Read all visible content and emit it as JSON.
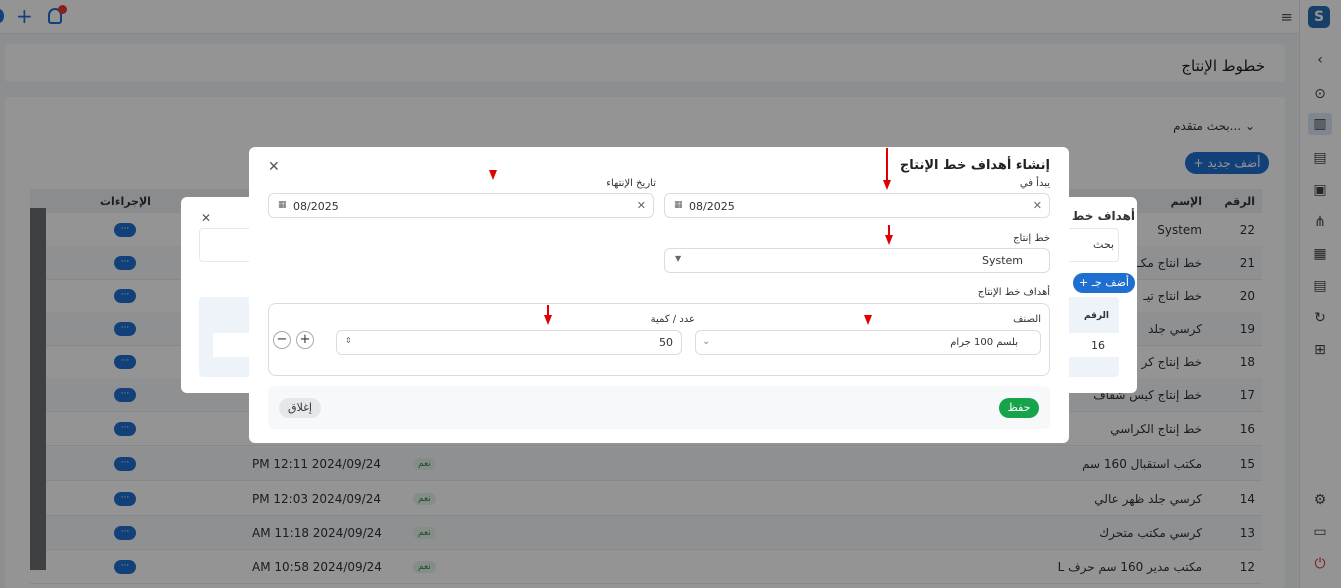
{
  "topbar": {
    "notification_badge": ""
  },
  "page": {
    "title": "خطوط الإنتاج"
  },
  "toolbar": {
    "advanced_search": "بحث متقدم...",
    "add_new": "+ أضف جديد"
  },
  "table": {
    "columns": {
      "number": "الرقم",
      "name": "الإسم",
      "actions": "الإجراءات"
    },
    "rows": [
      {
        "number": "22",
        "name": "System",
        "date": "",
        "badge": ""
      },
      {
        "number": "21",
        "name": "خط انتاج مكـ",
        "date": "",
        "badge": ""
      },
      {
        "number": "20",
        "name": "خط انتاج تيـ",
        "date": "",
        "badge": ""
      },
      {
        "number": "19",
        "name": "كرسي جلد",
        "date": "",
        "badge": ""
      },
      {
        "number": "18",
        "name": "خط إنتاج كر",
        "date": "",
        "badge": ""
      },
      {
        "number": "17",
        "name": "خط إنتاج كيس شفاف",
        "date": "",
        "badge": ""
      },
      {
        "number": "16",
        "name": "خط إنتاج الكراسي",
        "date": "",
        "badge": ""
      },
      {
        "number": "15",
        "name": "مكتب استقبال 160 سم",
        "date": "PM 12:11 2024/09/24",
        "badge": "نعم"
      },
      {
        "number": "14",
        "name": "كرسي جلد ظهر عالي",
        "date": "PM 12:03 2024/09/24",
        "badge": "نعم"
      },
      {
        "number": "13",
        "name": "كرسي مكتب متحرك",
        "date": "AM 11:18 2024/09/24",
        "badge": "نعم"
      },
      {
        "number": "12",
        "name": "مكتب مدير 160 سم حرف L",
        "date": "AM 10:58 2024/09/24",
        "badge": "نعم"
      }
    ],
    "action_label": "···"
  },
  "bg_modal": {
    "title": "أهداف خط",
    "search": "بحث",
    "add": "+ أضف جـ",
    "col_number": "الرقم",
    "cell_value": "16"
  },
  "modal": {
    "title": "إنشاء أهداف خط الإنتاج",
    "start_label": "يبدأ في",
    "start_value": "08/2025",
    "end_label": "تاريخ الإنتهاء",
    "end_value": "08/2025",
    "line_label": "خط إنتاج",
    "line_value": "System",
    "targets_label": "أهداف خط الإنتاج",
    "category_label": "الصنف",
    "category_value": "بلسم 100 جرام",
    "qty_label": "عدد / كمية",
    "qty_value": "50",
    "save": "حفظ",
    "close": "إغلاق"
  },
  "colors": {
    "primary": "#1f6fd0",
    "save": "#16a34a",
    "annotation_arrow": "#e00000"
  }
}
